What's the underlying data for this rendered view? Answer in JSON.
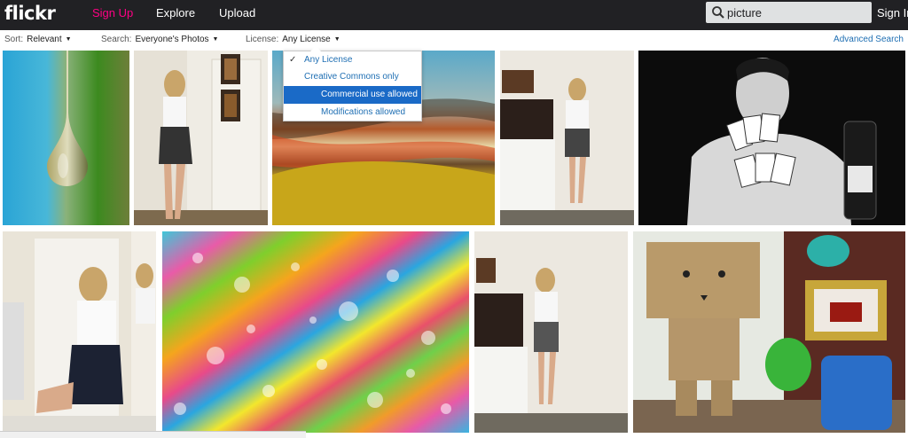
{
  "header": {
    "logo": "flickr",
    "nav": {
      "signup": "Sign Up",
      "explore": "Explore",
      "upload": "Upload"
    },
    "search_value": "picture",
    "signin": "Sign In"
  },
  "filters": {
    "sort_label": "Sort:",
    "sort_value": "Relevant",
    "search_label": "Search:",
    "search_value": "Everyone's Photos",
    "license_label": "License:",
    "license_value": "Any License",
    "advanced": "Advanced Search"
  },
  "license_menu": {
    "items": [
      "Any License",
      "Creative Commons only",
      "Commercial use allowed",
      "Modifications allowed"
    ],
    "checked_index": 0,
    "highlighted_index": 2
  },
  "status_bar": "",
  "colors": {
    "topbar": "#212124",
    "pink": "#ff0084",
    "link": "#1f6fb3",
    "highlight": "#1a6ac7"
  }
}
